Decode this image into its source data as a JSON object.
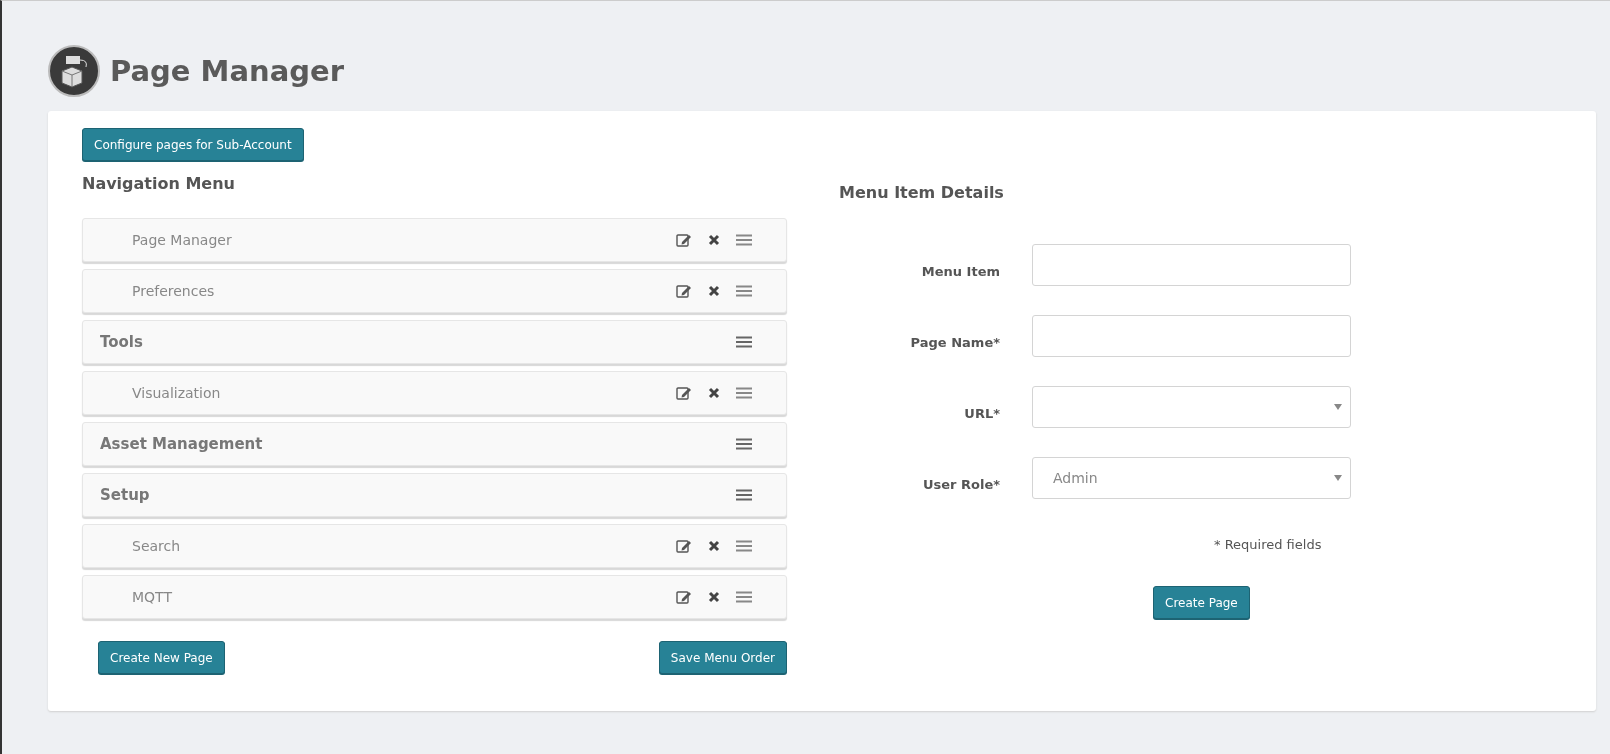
{
  "header": {
    "title": "Page Manager"
  },
  "subaccount_button": "Configure pages for Sub-Account",
  "navigation": {
    "title": "Navigation Menu",
    "items": [
      {
        "kind": "page",
        "label": "Page Manager"
      },
      {
        "kind": "page",
        "label": "Preferences"
      },
      {
        "kind": "group",
        "label": "Tools"
      },
      {
        "kind": "page",
        "label": "Visualization"
      },
      {
        "kind": "group",
        "label": "Asset Management"
      },
      {
        "kind": "group",
        "label": "Setup"
      },
      {
        "kind": "page",
        "label": "Search"
      },
      {
        "kind": "page",
        "label": "MQTT"
      }
    ],
    "buttons": [
      "Create New Page",
      "Save Menu Order"
    ]
  },
  "details": {
    "title": "Menu Item Details",
    "fields": [
      {
        "kind": "text",
        "label": "Menu Item"
      },
      {
        "kind": "text",
        "label": "Page Name*"
      },
      {
        "kind": "select",
        "label": "URL*"
      },
      {
        "kind": "select",
        "label": "User Role*",
        "value": "Admin"
      }
    ],
    "note": "* Required fields",
    "button": "Create Page"
  }
}
